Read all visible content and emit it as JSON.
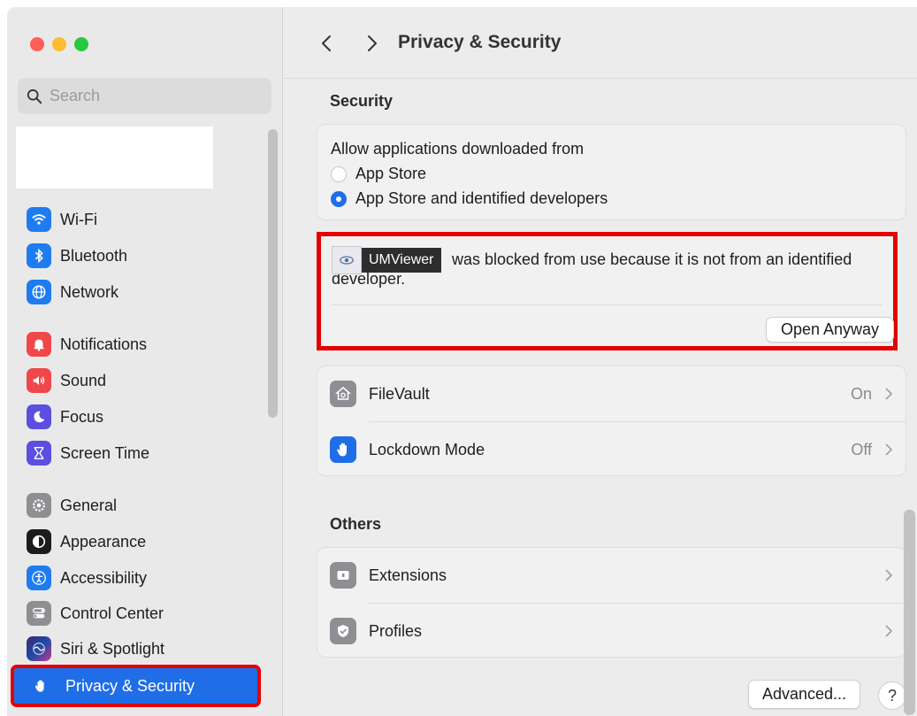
{
  "window": {
    "title": "Privacy & Security"
  },
  "search": {
    "placeholder": "Search"
  },
  "sidebar": {
    "items": [
      {
        "label": "Wi-Fi",
        "icon": "wifi-icon",
        "color": "#1f7cf0"
      },
      {
        "label": "Bluetooth",
        "icon": "bluetooth-icon",
        "color": "#1f7cf0"
      },
      {
        "label": "Network",
        "icon": "globe-icon",
        "color": "#1f7cf0"
      },
      {
        "label": "Notifications",
        "icon": "bell-icon",
        "color": "#f0474b"
      },
      {
        "label": "Sound",
        "icon": "speaker-icon",
        "color": "#f0474b"
      },
      {
        "label": "Focus",
        "icon": "moon-icon",
        "color": "#5b4ee0"
      },
      {
        "label": "Screen Time",
        "icon": "hourglass-icon",
        "color": "#5b4ee0"
      },
      {
        "label": "General",
        "icon": "gear-icon",
        "color": "#8e8e93"
      },
      {
        "label": "Appearance",
        "icon": "appearance-icon",
        "color": "#1c1c1e"
      },
      {
        "label": "Accessibility",
        "icon": "accessibility-icon",
        "color": "#1f7cf0"
      },
      {
        "label": "Control Center",
        "icon": "toggles-icon",
        "color": "#8e8e93"
      },
      {
        "label": "Siri & Spotlight",
        "icon": "siri-icon",
        "color": "#3a3a5c"
      },
      {
        "label": "Privacy & Security",
        "icon": "hand-icon",
        "color": "#1f6ee8",
        "selected": true
      }
    ]
  },
  "security": {
    "section_title": "Security",
    "allow_label": "Allow applications downloaded from",
    "options": [
      {
        "label": "App Store",
        "selected": false
      },
      {
        "label": "App Store and identified developers",
        "selected": true
      }
    ],
    "blocked_app_name": "UMViewer",
    "blocked_message": "was blocked from use because it is not from an identified developer.",
    "open_anyway_label": "Open Anyway",
    "rows": [
      {
        "label": "FileVault",
        "value": "On",
        "icon": "filevault-icon"
      },
      {
        "label": "Lockdown Mode",
        "value": "Off",
        "icon": "hand-icon"
      }
    ]
  },
  "others": {
    "section_title": "Others",
    "rows": [
      {
        "label": "Extensions",
        "icon": "extensions-icon"
      },
      {
        "label": "Profiles",
        "icon": "profiles-icon"
      }
    ]
  },
  "footer": {
    "advanced_label": "Advanced...",
    "help_label": "?"
  },
  "colors": {
    "accent": "#1f6ee8",
    "highlight_border": "#e20000"
  }
}
